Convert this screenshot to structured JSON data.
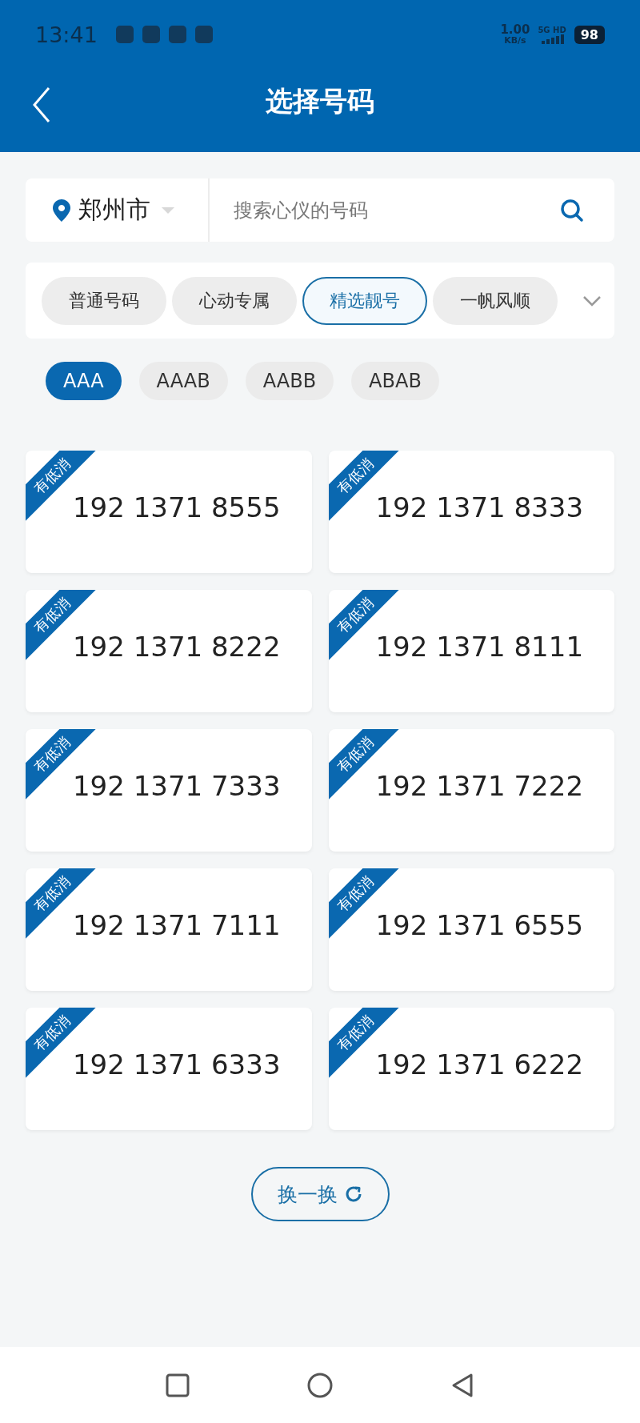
{
  "status_bar": {
    "time": "13:41",
    "net_speed": "1.00",
    "net_unit": "KB/s",
    "network": "5G HD",
    "battery": "98"
  },
  "header": {
    "title": "选择号码"
  },
  "search": {
    "city": "郑州市",
    "placeholder": "搜索心仪的号码"
  },
  "categories": [
    {
      "label": "普通号码",
      "selected": false
    },
    {
      "label": "心动专属",
      "selected": false
    },
    {
      "label": "精选靓号",
      "selected": true
    },
    {
      "label": "一帆风顺",
      "selected": false
    }
  ],
  "patterns": [
    {
      "label": "AAA",
      "selected": true
    },
    {
      "label": "AAAB",
      "selected": false
    },
    {
      "label": "AABB",
      "selected": false
    },
    {
      "label": "ABAB",
      "selected": false
    }
  ],
  "numbers": [
    {
      "number": "192 1371 8555",
      "tag": "有低消"
    },
    {
      "number": "192 1371 8333",
      "tag": "有低消"
    },
    {
      "number": "192 1371 8222",
      "tag": "有低消"
    },
    {
      "number": "192 1371 8111",
      "tag": "有低消"
    },
    {
      "number": "192 1371 7333",
      "tag": "有低消"
    },
    {
      "number": "192 1371 7222",
      "tag": "有低消"
    },
    {
      "number": "192 1371 7111",
      "tag": "有低消"
    },
    {
      "number": "192 1371 6555",
      "tag": "有低消"
    },
    {
      "number": "192 1371 6333",
      "tag": "有低消"
    },
    {
      "number": "192 1371 6222",
      "tag": "有低消"
    }
  ],
  "refresh_button": {
    "label": "换一换"
  }
}
